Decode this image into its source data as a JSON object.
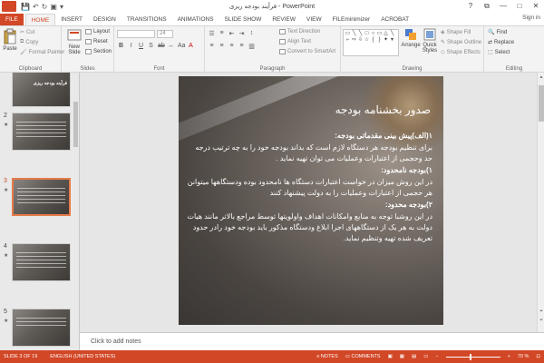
{
  "app": {
    "title": "فرآیند بودجه ریزی - PowerPoint",
    "window_controls": {
      "help": "?",
      "restore": "⧉",
      "minimize": "—",
      "maximize": "□",
      "close": "✕"
    }
  },
  "tabs": [
    "FILE",
    "HOME",
    "INSERT",
    "DESIGN",
    "TRANSITIONS",
    "ANIMATIONS",
    "SLIDE SHOW",
    "REVIEW",
    "VIEW",
    "FILEminimizer",
    "ACROBAT"
  ],
  "active_tab": "HOME",
  "signin": "Sign in",
  "ribbon": {
    "clipboard": {
      "label": "Clipboard",
      "paste": "Paste",
      "cut": "Cut",
      "copy": "Copy",
      "format_painter": "Format Painter"
    },
    "slides": {
      "label": "Slides",
      "new_slide": "New Slide",
      "layout": "Layout",
      "reset": "Reset",
      "section": "Section"
    },
    "font": {
      "label": "Font",
      "size": "24"
    },
    "paragraph": {
      "label": "Paragraph",
      "text_direction": "Text Direction",
      "align_text": "Align Text",
      "convert_smartart": "Convert to SmartArt"
    },
    "drawing": {
      "label": "Drawing",
      "arrange": "Arrange",
      "quick_styles": "Quick Styles",
      "shape_fill": "Shape Fill",
      "shape_outline": "Shape Outline",
      "shape_effects": "Shape Effects"
    },
    "editing": {
      "label": "Editing",
      "find": "Find",
      "replace": "Replace",
      "select": "Select"
    }
  },
  "thumbnails": [
    {
      "num": "",
      "title": "فرآیند بودجه ریزی"
    },
    {
      "num": "2",
      "title": ""
    },
    {
      "num": "3",
      "title": ""
    },
    {
      "num": "4",
      "title": ""
    },
    {
      "num": "5",
      "title": ""
    }
  ],
  "slide": {
    "title": "صدور بخشنامه بودجه",
    "paragraphs": [
      {
        "heading": true,
        "text": "۱(الف)پیش بینی مقدماتی بودجه:"
      },
      {
        "heading": false,
        "text": "برای تنظیم بودجه هر دستگاه لازم است که بداند بودجه خود را به چه ترتیب درجه حد وحجمی از اعتبارات وعملیات می توان تهیه نماید ."
      },
      {
        "heading": true,
        "text": "۱)بودجه نامحدود:"
      },
      {
        "heading": false,
        "text": "در این روش میزان در خواست اعتبارات دستگاه ها نامحدود بوده ودستگاهها میتوانن هر حجمی از اعتبارات وعملیات را به دولت پیشنهاد کنند"
      },
      {
        "heading": true,
        "text": "۲)بودجه محدود:"
      },
      {
        "heading": false,
        "text": "در این روشبا توجه به منابع وامکانات اهداف واولویتها توسط مراجع بالاتر مانند هیات دولت به هر یک از دستگاههای اجرا ابلاغ ودستگاه مذکور باید بودجه خود رادر حدود تعریف شده تهیه وتنظیم نماید."
      }
    ]
  },
  "notes_placeholder": "Click to add notes",
  "status": {
    "slide_info": "SLIDE 3 OF 19",
    "language": "ENGLISH (UNITED STATES)",
    "notes": "NOTES",
    "comments": "COMMENTS",
    "zoom": "70 %"
  },
  "colors": {
    "accent": "#d24726",
    "ribbon_bg": "#f3f3f3"
  }
}
